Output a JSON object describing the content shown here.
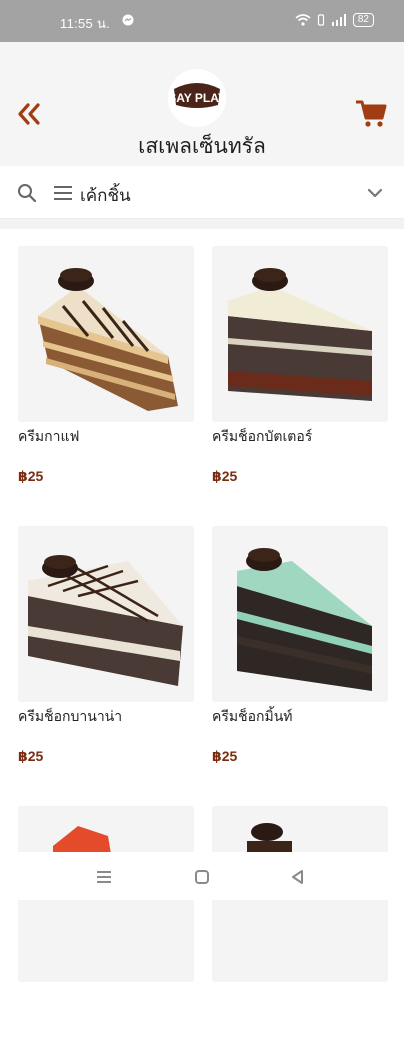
{
  "status_bar": {
    "time": "11:55 น.",
    "battery": "82",
    "icons": [
      "messenger-icon",
      "wifi-icon",
      "signal-icon",
      "battery-icon"
    ]
  },
  "header": {
    "logo_text": "SAY PLAY",
    "title": "เสเพลเซ็นทรัล",
    "icons": [
      "double-chevron-left-icon",
      "cart-icon"
    ]
  },
  "filter": {
    "category": "เค้กชิ้น",
    "icons": [
      "search-icon",
      "menu-icon",
      "chevron-down-icon"
    ]
  },
  "products": [
    {
      "name": "ครีมกาแฟ",
      "price": "฿25"
    },
    {
      "name": "ครีมช็อกบัตเตอร์",
      "price": "฿25"
    },
    {
      "name": "ครีมช็อกบานาน่า",
      "price": "฿25"
    },
    {
      "name": "ครีมช็อกมิ้นท์",
      "price": "฿25"
    }
  ],
  "colors": {
    "accent": "#a23c12",
    "price": "#7a2b10",
    "status_bar": "#a3a3a3",
    "header_bg": "#f5f5f5"
  },
  "nav_bar": {
    "icons": [
      "recent-apps-icon",
      "home-icon",
      "back-icon"
    ]
  }
}
